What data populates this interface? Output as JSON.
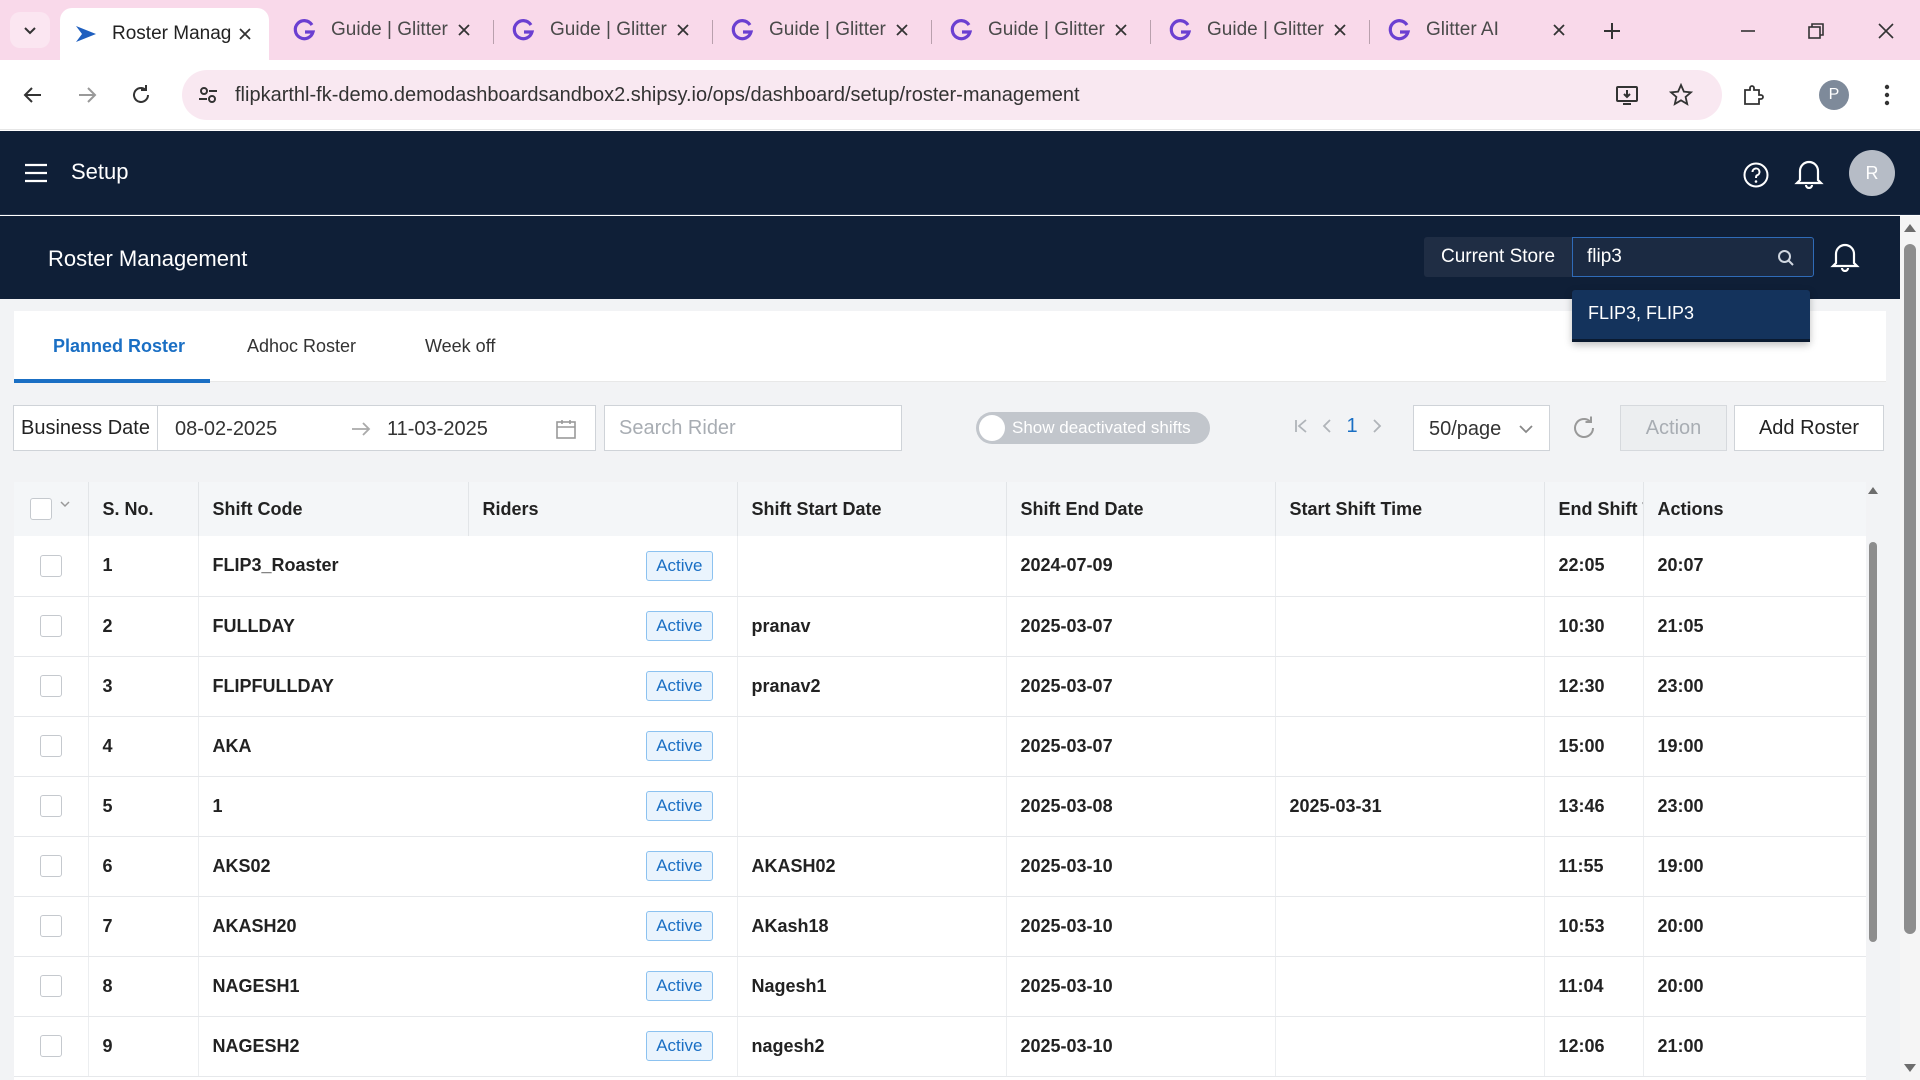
{
  "browser": {
    "tabs": [
      {
        "title": "Roster Manag",
        "active": true,
        "icon": "shipsy-icon"
      },
      {
        "title": "Guide | Glitter",
        "active": false,
        "icon": "glitter-icon"
      },
      {
        "title": "Guide | Glitter",
        "active": false,
        "icon": "glitter-icon"
      },
      {
        "title": "Guide | Glitter",
        "active": false,
        "icon": "glitter-icon"
      },
      {
        "title": "Guide | Glitter",
        "active": false,
        "icon": "glitter-icon"
      },
      {
        "title": "Guide | Glitter",
        "active": false,
        "icon": "glitter-icon"
      },
      {
        "title": "Glitter AI",
        "active": false,
        "icon": "glitter-icon"
      }
    ],
    "url": "flipkarthl-fk-demo.demodashboardsandbox2.shipsy.io/ops/dashboard/setup/roster-management",
    "profile_initial": "P"
  },
  "app": {
    "title": "Setup",
    "avatar_initial": "R",
    "page_title": "Roster Management",
    "store_label": "Current Store",
    "store_search_value": "flip3",
    "store_option": "FLIP3, FLIP3"
  },
  "tabs": [
    "Planned Roster",
    "Adhoc Roster",
    "Week off"
  ],
  "filters": {
    "business_date_label": "Business Date",
    "date_from": "08-02-2025",
    "date_to": "11-03-2025",
    "search_placeholder": "Search Rider",
    "toggle_label": "Show deactivated shifts",
    "page_number": "1",
    "page_size": "50/page",
    "action_label": "Action",
    "add_label": "Add Roster"
  },
  "table": {
    "headers": [
      "S. No.",
      "Shift Code",
      "Riders",
      "Shift Start Date",
      "Shift End Date",
      "Start Shift Time",
      "End Shift T",
      "Actions"
    ],
    "status_label": "Active",
    "rows": [
      {
        "sno": "1",
        "code": "FLIP3_Roaster",
        "riders": "",
        "start_date": "2024-07-09",
        "end_date": "",
        "start_time": "22:05",
        "end_time": "20:07"
      },
      {
        "sno": "2",
        "code": "FULLDAY",
        "riders": "pranav",
        "start_date": "2025-03-07",
        "end_date": "",
        "start_time": "10:30",
        "end_time": "21:05"
      },
      {
        "sno": "3",
        "code": "FLIPFULLDAY",
        "riders": "pranav2",
        "start_date": "2025-03-07",
        "end_date": "",
        "start_time": "12:30",
        "end_time": "23:00"
      },
      {
        "sno": "4",
        "code": "AKA",
        "riders": "",
        "start_date": "2025-03-07",
        "end_date": "",
        "start_time": "15:00",
        "end_time": "19:00"
      },
      {
        "sno": "5",
        "code": "1",
        "riders": "",
        "start_date": "2025-03-08",
        "end_date": "2025-03-31",
        "start_time": "13:46",
        "end_time": "23:00"
      },
      {
        "sno": "6",
        "code": "AKS02",
        "riders": "AKASH02",
        "start_date": "2025-03-10",
        "end_date": "",
        "start_time": "11:55",
        "end_time": "19:00"
      },
      {
        "sno": "7",
        "code": "AKASH20",
        "riders": "AKash18",
        "start_date": "2025-03-10",
        "end_date": "",
        "start_time": "10:53",
        "end_time": "20:00"
      },
      {
        "sno": "8",
        "code": "NAGESH1",
        "riders": "Nagesh1",
        "start_date": "2025-03-10",
        "end_date": "",
        "start_time": "11:04",
        "end_time": "20:00"
      },
      {
        "sno": "9",
        "code": "NAGESH2",
        "riders": "nagesh2",
        "start_date": "2025-03-10",
        "end_date": "",
        "start_time": "12:06",
        "end_time": "21:00"
      }
    ]
  },
  "colors": {
    "header_bg": "#0f1f37",
    "accent": "#1a6fc4",
    "tabbar_bg": "#f9d9ea"
  }
}
